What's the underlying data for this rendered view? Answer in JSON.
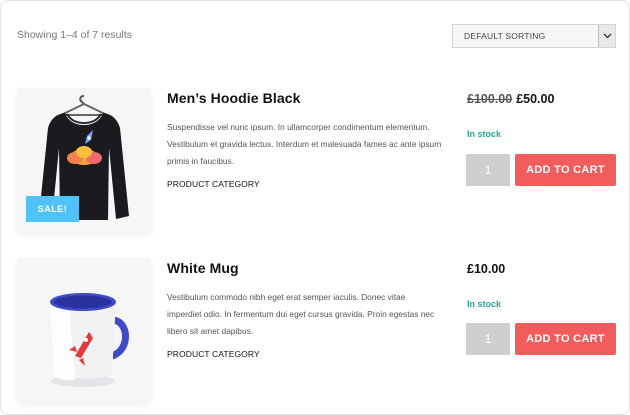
{
  "shop": {
    "result_count": "Showing 1–4 of 7 results",
    "sorting": {
      "selected": "DEFAULT SORTING"
    }
  },
  "products": [
    {
      "title": "Men’s Hoodie Black",
      "badge": "SALE!",
      "description": "Suspendisse vel nunc ipsum. In ullamcorper condimentum elementum. Vestibulum et gravida lectus. Interdum et malesuada fames ac ante ipsum primis in faucibus.",
      "category": "PRODUCT CATEGORY",
      "price_old": "£100.00",
      "price": "£50.00",
      "stock": "In stock",
      "quantity": "1",
      "add_to_cart": "ADD TO CART",
      "image_icon": "hoodie-icon"
    },
    {
      "title": "White Mug",
      "description": "Vestibulum commodo nibh eget erat semper iaculis. Donec vitae imperdiet odio. In fermentum dui eget cursus gravida. Proin egestas nec libero sit amet dapibus.",
      "category": "PRODUCT CATEGORY",
      "price": "£10.00",
      "stock": "In stock",
      "quantity": "1",
      "add_to_cart": "ADD TO CART",
      "image_icon": "mug-icon"
    }
  ],
  "colors": {
    "sale_badge": "#4fc3f7",
    "in_stock": "#26a69a",
    "add_to_cart": "#f25c5c",
    "quantity_box": "#cfcfcf"
  }
}
